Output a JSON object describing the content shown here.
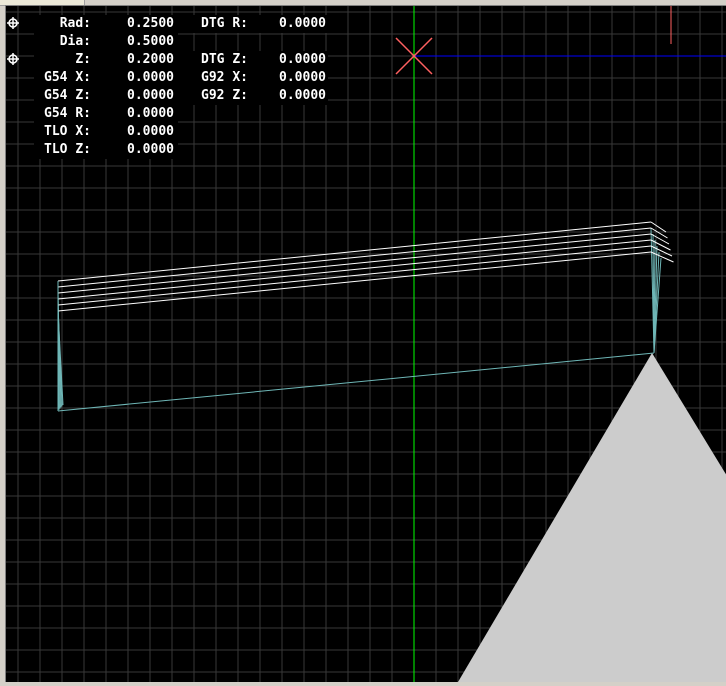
{
  "dro": {
    "rows": [
      {
        "label": "Rad:",
        "value": "0.2500",
        "label2": "DTG R:",
        "value2": "0.0000"
      },
      {
        "label": "Dia:",
        "value": "0.5000",
        "label2": "",
        "value2": ""
      },
      {
        "label": "Z:",
        "value": "0.2000",
        "label2": "DTG Z:",
        "value2": "0.0000"
      },
      {
        "label": "G54 X:",
        "value": "0.0000",
        "label2": "G92 X:",
        "value2": "0.0000"
      },
      {
        "label": "G54 Z:",
        "value": "0.0000",
        "label2": "G92 Z:",
        "value2": "0.0000"
      },
      {
        "label": "G54 R:",
        "value": "0.0000",
        "label2": "",
        "value2": ""
      },
      {
        "label": "TLO X:",
        "value": "0.0000",
        "label2": "",
        "value2": ""
      },
      {
        "label": "TLO Z:",
        "value": "0.0000",
        "label2": "",
        "value2": ""
      }
    ]
  },
  "icons": [
    "crosshair-icon",
    "origin-marker-icon"
  ],
  "colors": {
    "background": "#000000",
    "grid": "#3a3a3a",
    "axis_z": "#00ff00",
    "axis_x": "#0000ff",
    "origin": "#ff6060",
    "toolpath": "#ffffff",
    "rapid": "#60c0c0",
    "tool": "#cccccc"
  }
}
